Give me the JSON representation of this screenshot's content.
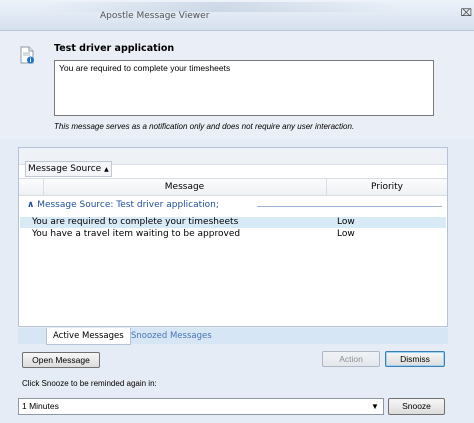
{
  "window": {
    "title": "Apostle Message Viewer",
    "close_glyph": "⌧"
  },
  "header": {
    "app_name": "Test driver application",
    "message": "You are required to complete your timesheets",
    "note": "This message serves as a notification only and does not require any user interaction.",
    "icon": "message-info-icon"
  },
  "grid": {
    "group_by": "Message Source",
    "group_sort_glyph": "▲",
    "columns": [
      "Message",
      "Priority"
    ],
    "group_label": "Message Source: Test driver application;",
    "group_toggle_glyph": "∧",
    "rows": [
      {
        "message": "You are required to complete your timesheets",
        "priority": "Low"
      },
      {
        "message": "You have a travel item waiting to be approved",
        "priority": "Low"
      }
    ]
  },
  "tabs": [
    "Active Messages",
    "Snoozed Messages"
  ],
  "buttons": {
    "open": "Open Message",
    "action": "Action",
    "dismiss": "Dismiss",
    "snooze": "Snooze"
  },
  "snooze": {
    "label": "Click Snooze to be reminded again in:",
    "selected": "1 Minutes",
    "dropdown_glyph": "▼"
  }
}
